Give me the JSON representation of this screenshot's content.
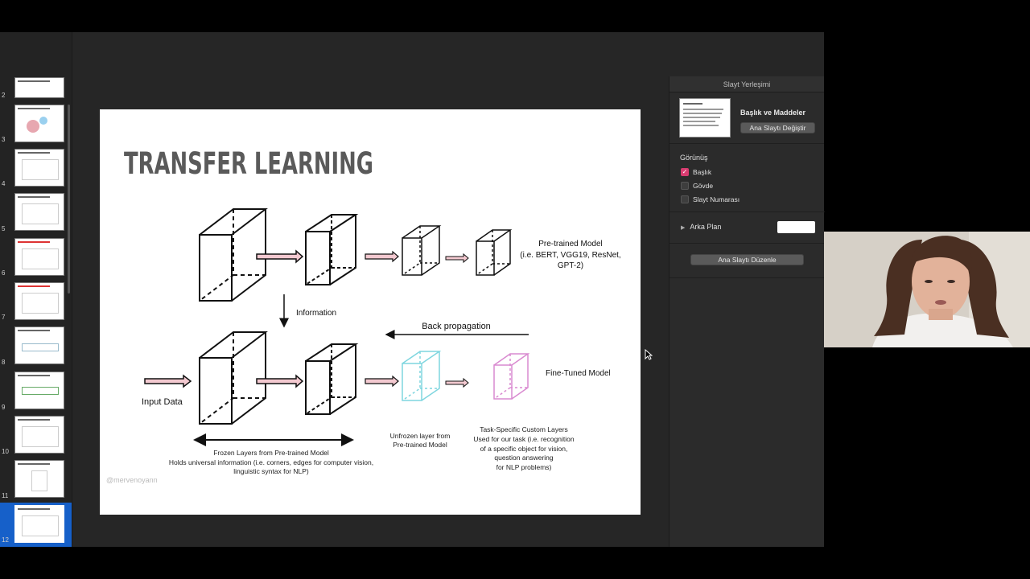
{
  "thumbnails": [
    {
      "num": "2",
      "title": ""
    },
    {
      "num": "3",
      "title": "WHAT ARE LANGUAGE MODELS?"
    },
    {
      "num": "4",
      "title": ""
    },
    {
      "num": "5",
      "title": ""
    },
    {
      "num": "6",
      "title": ""
    },
    {
      "num": "7",
      "title": ""
    },
    {
      "num": "8",
      "title": ""
    },
    {
      "num": "9",
      "title": ""
    },
    {
      "num": "10",
      "title": ""
    },
    {
      "num": "11",
      "title": ""
    },
    {
      "num": "12",
      "title": "TRANSFER LEARNING"
    }
  ],
  "slide": {
    "title": "TRANSFER LEARNING",
    "pretrained_label_1": "Pre-trained Model",
    "pretrained_label_2": "(i.e. BERT, VGG19, ResNet,",
    "pretrained_label_3": "GPT-2)",
    "information": "Information",
    "back_propagation": "Back propagation",
    "finetuned": "Fine-Tuned Model",
    "input_data": "Input Data",
    "unfrozen_1": "Unfrozen layer from",
    "unfrozen_2": "Pre-trained Model",
    "task_1": "Task-Specific Custom Layers",
    "task_2": "Used for our task (i.e. recognition",
    "task_3": "of  a specific object for vision,",
    "task_4": "question answering",
    "task_5": "for NLP problems)",
    "frozen_1": "Frozen Layers from Pre-trained Model",
    "frozen_2": "Holds universal information (i.e. corners, edges for computer vision,",
    "frozen_3": "linguistic syntax for NLP)",
    "watermark": "@mervenoyann"
  },
  "inspector": {
    "header": "Slayt Yerleşimi",
    "layout_name": "Başlık ve Maddeler",
    "change_master_button": "Ana Slaytı Değiştir",
    "appearance_title": "Görünüş",
    "checkboxes": [
      {
        "label": "Başlık",
        "checked": true
      },
      {
        "label": "Gövde",
        "checked": false
      },
      {
        "label": "Slayt Numarası",
        "checked": false
      }
    ],
    "background_label": "Arka Plan",
    "background_color": "#ffffff",
    "edit_master_button": "Ana Slaytı Düzenle"
  },
  "colors": {
    "accent": "#d83c70",
    "selection": "#1660c9",
    "unfrozen_layer": "#7fd6df",
    "custom_layer": "#d98ad0",
    "arrow_fill": "#f3c9d0"
  }
}
